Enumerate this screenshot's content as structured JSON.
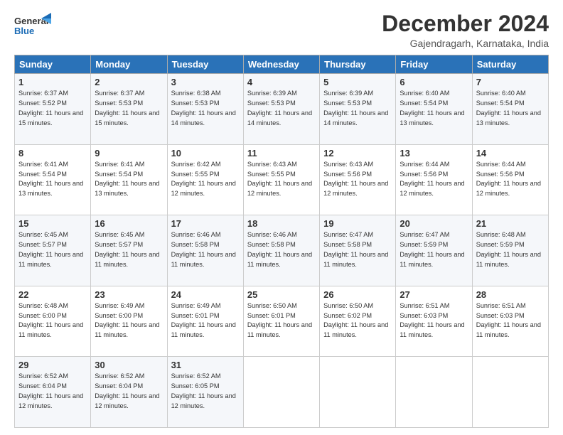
{
  "header": {
    "logo_general": "General",
    "logo_blue": "Blue",
    "month_title": "December 2024",
    "location": "Gajendragarh, Karnataka, India"
  },
  "weekdays": [
    "Sunday",
    "Monday",
    "Tuesday",
    "Wednesday",
    "Thursday",
    "Friday",
    "Saturday"
  ],
  "weeks": [
    [
      {
        "day": "1",
        "sunrise": "Sunrise: 6:37 AM",
        "sunset": "Sunset: 5:52 PM",
        "daylight": "Daylight: 11 hours and 15 minutes."
      },
      {
        "day": "2",
        "sunrise": "Sunrise: 6:37 AM",
        "sunset": "Sunset: 5:53 PM",
        "daylight": "Daylight: 11 hours and 15 minutes."
      },
      {
        "day": "3",
        "sunrise": "Sunrise: 6:38 AM",
        "sunset": "Sunset: 5:53 PM",
        "daylight": "Daylight: 11 hours and 14 minutes."
      },
      {
        "day": "4",
        "sunrise": "Sunrise: 6:39 AM",
        "sunset": "Sunset: 5:53 PM",
        "daylight": "Daylight: 11 hours and 14 minutes."
      },
      {
        "day": "5",
        "sunrise": "Sunrise: 6:39 AM",
        "sunset": "Sunset: 5:53 PM",
        "daylight": "Daylight: 11 hours and 14 minutes."
      },
      {
        "day": "6",
        "sunrise": "Sunrise: 6:40 AM",
        "sunset": "Sunset: 5:54 PM",
        "daylight": "Daylight: 11 hours and 13 minutes."
      },
      {
        "day": "7",
        "sunrise": "Sunrise: 6:40 AM",
        "sunset": "Sunset: 5:54 PM",
        "daylight": "Daylight: 11 hours and 13 minutes."
      }
    ],
    [
      {
        "day": "8",
        "sunrise": "Sunrise: 6:41 AM",
        "sunset": "Sunset: 5:54 PM",
        "daylight": "Daylight: 11 hours and 13 minutes."
      },
      {
        "day": "9",
        "sunrise": "Sunrise: 6:41 AM",
        "sunset": "Sunset: 5:54 PM",
        "daylight": "Daylight: 11 hours and 13 minutes."
      },
      {
        "day": "10",
        "sunrise": "Sunrise: 6:42 AM",
        "sunset": "Sunset: 5:55 PM",
        "daylight": "Daylight: 11 hours and 12 minutes."
      },
      {
        "day": "11",
        "sunrise": "Sunrise: 6:43 AM",
        "sunset": "Sunset: 5:55 PM",
        "daylight": "Daylight: 11 hours and 12 minutes."
      },
      {
        "day": "12",
        "sunrise": "Sunrise: 6:43 AM",
        "sunset": "Sunset: 5:56 PM",
        "daylight": "Daylight: 11 hours and 12 minutes."
      },
      {
        "day": "13",
        "sunrise": "Sunrise: 6:44 AM",
        "sunset": "Sunset: 5:56 PM",
        "daylight": "Daylight: 11 hours and 12 minutes."
      },
      {
        "day": "14",
        "sunrise": "Sunrise: 6:44 AM",
        "sunset": "Sunset: 5:56 PM",
        "daylight": "Daylight: 11 hours and 12 minutes."
      }
    ],
    [
      {
        "day": "15",
        "sunrise": "Sunrise: 6:45 AM",
        "sunset": "Sunset: 5:57 PM",
        "daylight": "Daylight: 11 hours and 11 minutes."
      },
      {
        "day": "16",
        "sunrise": "Sunrise: 6:45 AM",
        "sunset": "Sunset: 5:57 PM",
        "daylight": "Daylight: 11 hours and 11 minutes."
      },
      {
        "day": "17",
        "sunrise": "Sunrise: 6:46 AM",
        "sunset": "Sunset: 5:58 PM",
        "daylight": "Daylight: 11 hours and 11 minutes."
      },
      {
        "day": "18",
        "sunrise": "Sunrise: 6:46 AM",
        "sunset": "Sunset: 5:58 PM",
        "daylight": "Daylight: 11 hours and 11 minutes."
      },
      {
        "day": "19",
        "sunrise": "Sunrise: 6:47 AM",
        "sunset": "Sunset: 5:58 PM",
        "daylight": "Daylight: 11 hours and 11 minutes."
      },
      {
        "day": "20",
        "sunrise": "Sunrise: 6:47 AM",
        "sunset": "Sunset: 5:59 PM",
        "daylight": "Daylight: 11 hours and 11 minutes."
      },
      {
        "day": "21",
        "sunrise": "Sunrise: 6:48 AM",
        "sunset": "Sunset: 5:59 PM",
        "daylight": "Daylight: 11 hours and 11 minutes."
      }
    ],
    [
      {
        "day": "22",
        "sunrise": "Sunrise: 6:48 AM",
        "sunset": "Sunset: 6:00 PM",
        "daylight": "Daylight: 11 hours and 11 minutes."
      },
      {
        "day": "23",
        "sunrise": "Sunrise: 6:49 AM",
        "sunset": "Sunset: 6:00 PM",
        "daylight": "Daylight: 11 hours and 11 minutes."
      },
      {
        "day": "24",
        "sunrise": "Sunrise: 6:49 AM",
        "sunset": "Sunset: 6:01 PM",
        "daylight": "Daylight: 11 hours and 11 minutes."
      },
      {
        "day": "25",
        "sunrise": "Sunrise: 6:50 AM",
        "sunset": "Sunset: 6:01 PM",
        "daylight": "Daylight: 11 hours and 11 minutes."
      },
      {
        "day": "26",
        "sunrise": "Sunrise: 6:50 AM",
        "sunset": "Sunset: 6:02 PM",
        "daylight": "Daylight: 11 hours and 11 minutes."
      },
      {
        "day": "27",
        "sunrise": "Sunrise: 6:51 AM",
        "sunset": "Sunset: 6:03 PM",
        "daylight": "Daylight: 11 hours and 11 minutes."
      },
      {
        "day": "28",
        "sunrise": "Sunrise: 6:51 AM",
        "sunset": "Sunset: 6:03 PM",
        "daylight": "Daylight: 11 hours and 11 minutes."
      }
    ],
    [
      {
        "day": "29",
        "sunrise": "Sunrise: 6:52 AM",
        "sunset": "Sunset: 6:04 PM",
        "daylight": "Daylight: 11 hours and 12 minutes."
      },
      {
        "day": "30",
        "sunrise": "Sunrise: 6:52 AM",
        "sunset": "Sunset: 6:04 PM",
        "daylight": "Daylight: 11 hours and 12 minutes."
      },
      {
        "day": "31",
        "sunrise": "Sunrise: 6:52 AM",
        "sunset": "Sunset: 6:05 PM",
        "daylight": "Daylight: 11 hours and 12 minutes."
      },
      null,
      null,
      null,
      null
    ]
  ]
}
